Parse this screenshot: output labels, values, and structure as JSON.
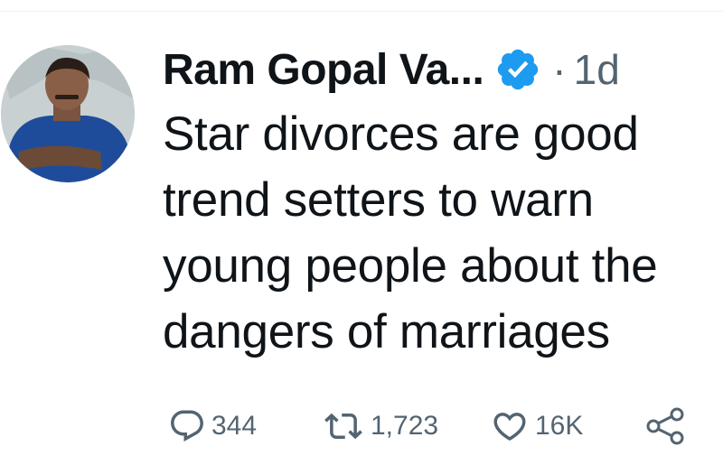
{
  "tweet": {
    "author_name": "Ram Gopal Va...",
    "verified_icon": "verified-badge-icon",
    "separator": "·",
    "time": "1d",
    "text": "Star divorces are good trend setters to warn young people about the dangers of marriages"
  },
  "actions": {
    "reply": {
      "icon": "reply-icon",
      "count": "344"
    },
    "retweet": {
      "icon": "retweet-icon",
      "count": "1,723"
    },
    "like": {
      "icon": "heart-icon",
      "count": "16K"
    },
    "share": {
      "icon": "share-icon"
    }
  },
  "colors": {
    "verified_blue": "#1d9bf0",
    "muted_text": "#536471",
    "text": "#0f1419"
  }
}
